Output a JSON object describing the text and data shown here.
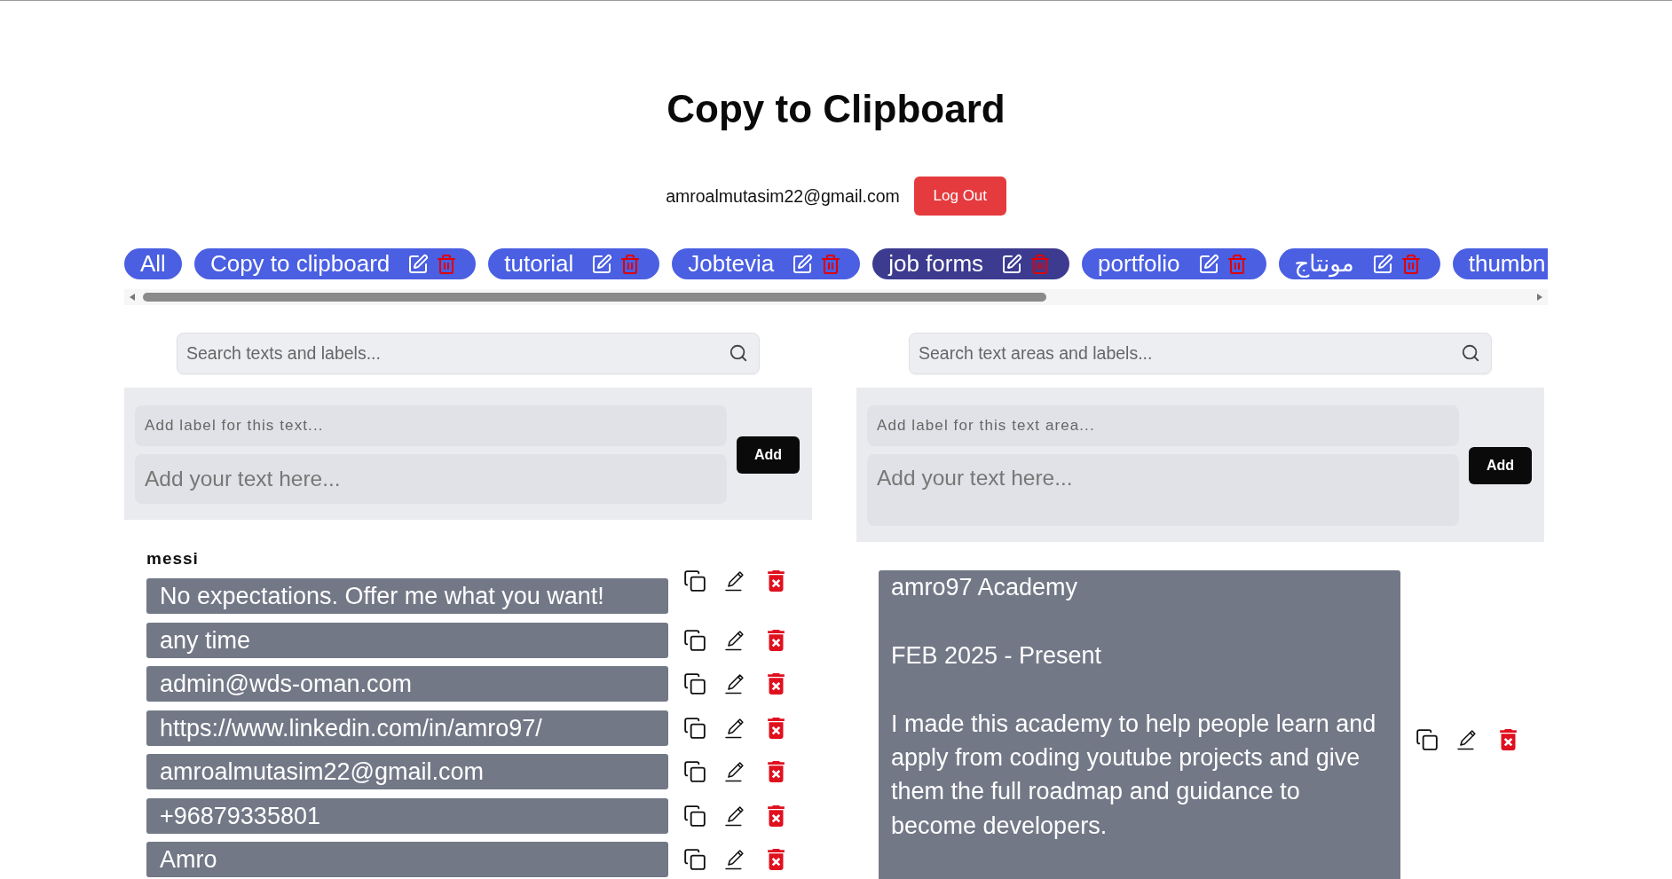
{
  "header": {
    "title": "Copy to Clipboard",
    "email": "amroalmutasim22@gmail.com",
    "logout_button": "Log Out"
  },
  "categories": [
    {
      "label": "All",
      "selected": false,
      "editable": false
    },
    {
      "label": "Copy to clipboard",
      "selected": false,
      "editable": true
    },
    {
      "label": "tutorial",
      "selected": false,
      "editable": true
    },
    {
      "label": "Jobtevia",
      "selected": false,
      "editable": true
    },
    {
      "label": "job forms",
      "selected": true,
      "editable": true
    },
    {
      "label": "portfolio",
      "selected": false,
      "editable": true
    },
    {
      "label": "مونتاج",
      "selected": false,
      "editable": true
    },
    {
      "label": "thumbn",
      "selected": false,
      "editable": false
    }
  ],
  "texts_panel": {
    "search": {
      "placeholder": "Search texts and labels..."
    },
    "form": {
      "label_placeholder": "Add label for this text...",
      "text_placeholder": "Add your text here...",
      "add_button": "Add"
    },
    "items": [
      {
        "label": "messi",
        "text": "No expectations. Offer me what you want!"
      },
      {
        "text": "any time"
      },
      {
        "text": "admin@wds-oman.com"
      },
      {
        "text": "https://www.linkedin.com/in/amro97/"
      },
      {
        "text": "amroalmutasim22@gmail.com"
      },
      {
        "text": "+96879335801"
      },
      {
        "text": "Amro"
      }
    ]
  },
  "text_areas_panel": {
    "search": {
      "placeholder": "Search text areas and labels..."
    },
    "form": {
      "label_placeholder": "Add label for this text area...",
      "text_placeholder": "Add your text here...",
      "add_button": "Add"
    },
    "items": [
      {
        "text": "amro97 Academy\n\nFEB 2025 - Present\n\nI made this academy to help people learn and apply from coding youtube projects and give them the full roadmap and guidance to become developers."
      }
    ]
  }
}
